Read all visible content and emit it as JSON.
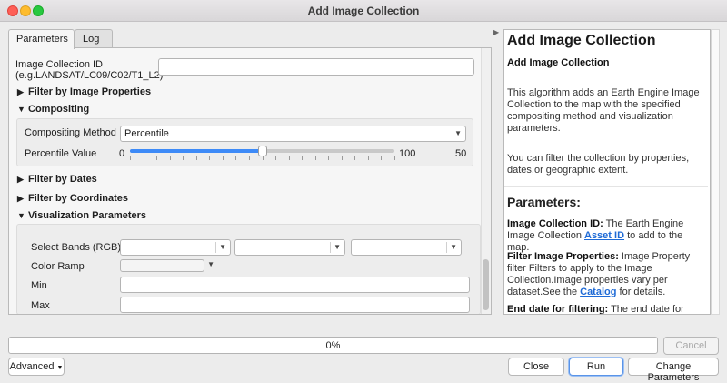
{
  "window": {
    "title": "Add Image Collection"
  },
  "tabs": [
    {
      "label": "Parameters",
      "active": true
    },
    {
      "label": "Log",
      "active": false
    }
  ],
  "params": {
    "collection_id": {
      "label_line1": "Image Collection ID",
      "label_line2": "(e.g.LANDSAT/LC09/C02/T1_L2)",
      "value": ""
    },
    "filter_properties": {
      "label": "Filter by Image Properties",
      "expanded": false
    },
    "compositing": {
      "label": "Compositing",
      "expanded": true,
      "method_label": "Compositing Method",
      "method_value": "Percentile",
      "percentile_label": "Percentile Value",
      "slider_min": "0",
      "slider_max": "100",
      "slider_value": "50",
      "slider_fraction": 0.5
    },
    "filter_dates": {
      "label": "Filter by Dates",
      "expanded": false
    },
    "filter_coords": {
      "label": "Filter by Coordinates",
      "expanded": false
    },
    "visualization": {
      "label": "Visualization Parameters",
      "expanded": true,
      "bands_label": "Select Bands (RGB)",
      "bands": [
        "",
        "",
        ""
      ],
      "color_ramp_label": "Color Ramp",
      "min_label": "Min",
      "min_value": "",
      "max_label": "Max",
      "max_value": ""
    }
  },
  "help": {
    "title": "Add Image Collection",
    "subtitle": "Add Image Collection",
    "desc1": "This algorithm adds an Earth Engine Image Collection to the map with the specified compositing method and visualization parameters.",
    "desc2": "You can filter the collection by properties, dates,or geographic extent.",
    "params_heading": "Parameters:",
    "p1_term": "Image Collection ID:",
    "p1_text_a": " The Earth Engine Image Collection ",
    "p1_link": "Asset ID",
    "p1_text_b": " to add to the map.",
    "p2_term": "Filter Image Properties:",
    "p2_text_a": " Image Property filter Filters to apply to the Image Collection.Image properties vary per dataset.See the ",
    "p2_link": "Catalog",
    "p2_text_b": " for details.",
    "p3_term": "End date for filtering:",
    "p3_text": " The end date for"
  },
  "footer": {
    "progress_text": "0%",
    "progress_fraction": 0,
    "cancel": "Cancel",
    "advanced": "Advanced",
    "close": "Close",
    "run": "Run",
    "change_params": "Change Parameters"
  }
}
